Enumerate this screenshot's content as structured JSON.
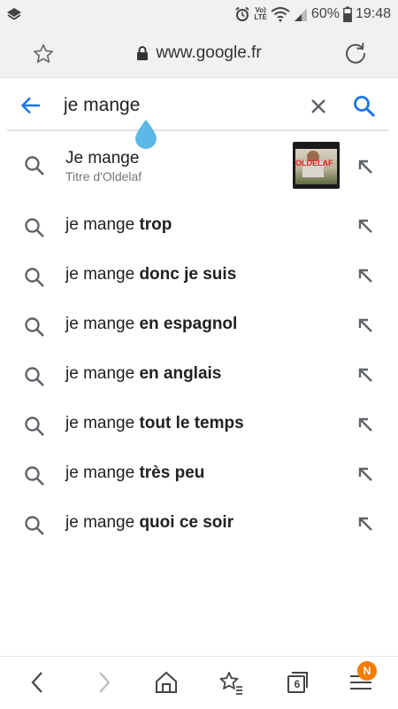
{
  "status_bar": {
    "volte_top": "Vo)",
    "volte_bottom": "LTE",
    "battery": "60%",
    "time": "19:48"
  },
  "url_bar": {
    "url": "www.google.fr"
  },
  "search": {
    "query": "je mange"
  },
  "suggestions": {
    "first": {
      "title": "Je mange",
      "subtitle": "Titre d'Oldelaf",
      "thumb_text": "OLDELAF"
    },
    "items": [
      {
        "prefix": "je mange ",
        "bold": "trop"
      },
      {
        "prefix": "je mange ",
        "bold": "donc je suis"
      },
      {
        "prefix": "je mange ",
        "bold": "en espagnol"
      },
      {
        "prefix": "je mange ",
        "bold": "en anglais"
      },
      {
        "prefix": "je mange ",
        "bold": "tout le temps"
      },
      {
        "prefix": "je mange ",
        "bold": "très peu"
      },
      {
        "prefix": "je mange ",
        "bold": "quoi ce soir"
      }
    ]
  },
  "bottom_nav": {
    "tab_count": "6",
    "badge": "N"
  },
  "colors": {
    "accent_blue": "#1a73e8",
    "icon_gray": "#5f6368",
    "badge_orange": "#f57c00",
    "cursor_drop": "#5cb8e6"
  },
  "icons": [
    "layers-icon",
    "alarm-icon",
    "wifi-icon",
    "signal-icon",
    "battery-icon",
    "star-icon",
    "lock-icon",
    "reload-icon",
    "back-arrow-icon",
    "clear-icon",
    "search-icon",
    "fill-query-arrow-icon",
    "nav-back-icon",
    "nav-forward-icon",
    "home-icon",
    "bookmark-star-icon",
    "tabs-icon",
    "menu-icon"
  ]
}
